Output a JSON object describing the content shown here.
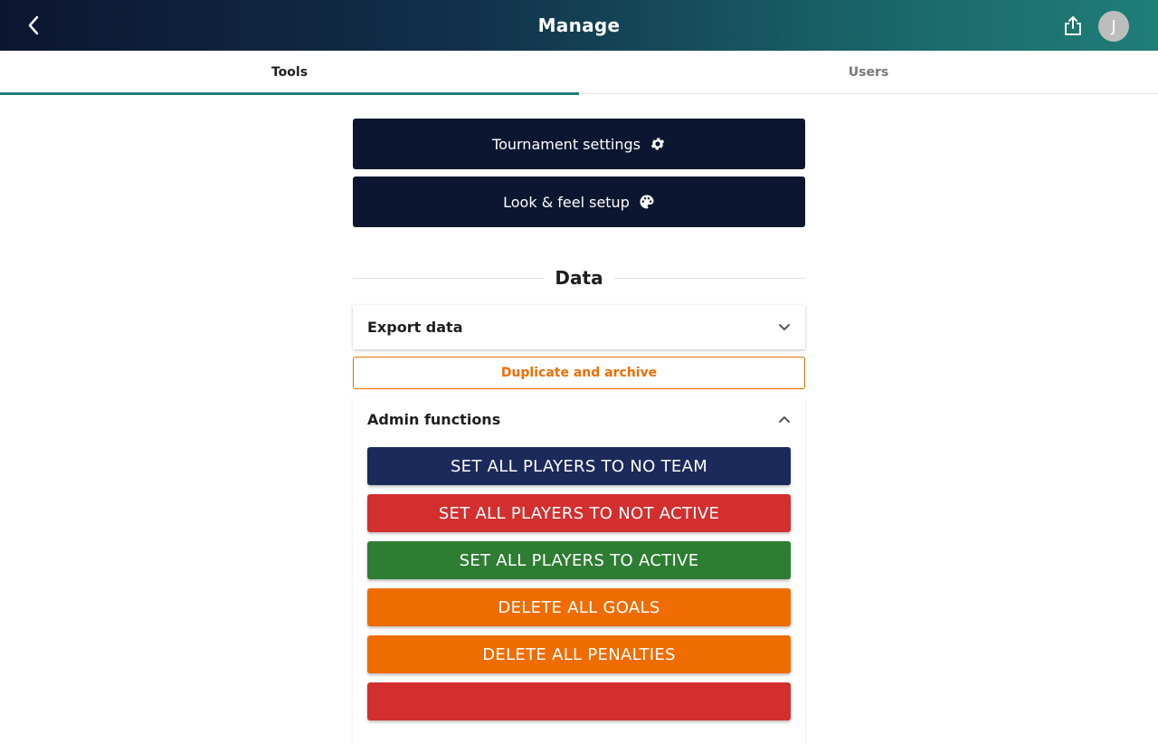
{
  "header": {
    "title": "Manage",
    "avatar_initial": "J"
  },
  "tabs": [
    {
      "label": "Tools",
      "active": true
    },
    {
      "label": "Users",
      "active": false
    }
  ],
  "main": {
    "tournament_settings_label": "Tournament settings",
    "look_feel_label": "Look & feel setup",
    "data_heading": "Data",
    "export_data_label": "Export data",
    "duplicate_archive_label": "Duplicate and archive",
    "admin_functions_label": "Admin functions",
    "admin_buttons": [
      {
        "label": "SET ALL PLAYERS TO NO TEAM",
        "color": "#1b2a5a"
      },
      {
        "label": "SET ALL PLAYERS TO NOT ACTIVE",
        "color": "#d32f2f"
      },
      {
        "label": "SET ALL PLAYERS TO ACTIVE",
        "color": "#2e7d32"
      },
      {
        "label": "DELETE ALL GOALS",
        "color": "#ef6c00"
      },
      {
        "label": "DELETE ALL PENALTIES",
        "color": "#ef6c00"
      },
      {
        "label": "",
        "color": "#d32f2f"
      }
    ]
  },
  "colors": {
    "primary_dark": "#0c1630",
    "accent_teal": "#1f7d76",
    "warning_orange": "#ef6c00"
  },
  "icons": {
    "back": "chevron-left-icon",
    "share": "share-icon",
    "settings": "gear-icon",
    "palette": "palette-icon",
    "expand": "chevron-down-icon",
    "collapse": "chevron-up-icon"
  }
}
